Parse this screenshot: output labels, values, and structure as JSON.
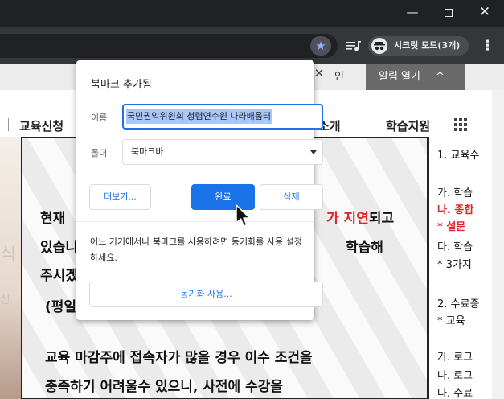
{
  "window": {
    "minimize": "—",
    "close": "✕"
  },
  "toolbar": {
    "bookmark_star": "★",
    "incognito_label": "시크릿 모드(3개)",
    "menu": "⋮"
  },
  "page": {
    "login": "인",
    "alarm_button": "알림 열기",
    "alarm_caret": "^",
    "nav": {
      "item1": "교육신청",
      "item2": "소개",
      "item3": "학습지원"
    },
    "left_image_ghost": [
      "식",
      "신"
    ],
    "panel": {
      "line1_start": "현재 ",
      "line1_red": "가 지연",
      "line1_end": "되고",
      "line2_start": "있습니",
      "line2_end": "학습해",
      "line3": "주시겠",
      "line4": "(평일",
      "line5": "교육 마감주에 접속자가 많을 경우 이수 조건을",
      "line6": "충족하기 어려울수 있으니, 사전에 수강을"
    },
    "right_col": [
      {
        "text": "1. 교육수",
        "red": false
      },
      {
        "text": "가. 학습",
        "red": false
      },
      {
        "text": "나. 종합",
        "red": true
      },
      {
        "text": " * 설문",
        "red": true
      },
      {
        "text": "다. 학습",
        "red": false
      },
      {
        "text": " * 3가지",
        "red": false
      },
      {
        "text": "2. 수료증",
        "red": false
      },
      {
        "text": " * 교육",
        "red": false
      },
      {
        "text": "가. 로그",
        "red": false
      },
      {
        "text": "나. 로그",
        "red": false
      },
      {
        "text": "다. 수료",
        "red": false
      }
    ]
  },
  "dialog": {
    "title": "북마크 추가됨",
    "close": "✕",
    "name_label": "이름",
    "name_value": "국민권익위원회 청렴연수원 나라배움터",
    "folder_label": "폴더",
    "folder_value": "북마크바",
    "more_button": "더보기...",
    "done_button": "완료",
    "delete_button": "삭제",
    "sync_message": "어느 기기에서나 북마크를 사용하려면 동기화를 사용 설정하세요.",
    "sync_button": "동기화 사용..."
  }
}
